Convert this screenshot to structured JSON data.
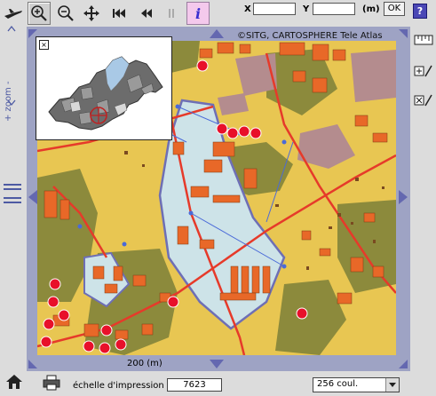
{
  "toolbar": {
    "tools": [
      {
        "name": "hand-pan"
      },
      {
        "name": "zoom-in",
        "active": true
      },
      {
        "name": "zoom-out"
      },
      {
        "name": "move"
      },
      {
        "name": "first-view"
      },
      {
        "name": "previous-view"
      },
      {
        "name": "next-view"
      },
      {
        "name": "info"
      }
    ],
    "info_label": "i",
    "x_label": "X",
    "y_label": "Y",
    "x_value": "",
    "y_value": "",
    "unit_label": "(m)",
    "ok_label": "OK",
    "help_label": "?"
  },
  "zoom": {
    "label": "+ zoom -"
  },
  "map": {
    "copyright": "©SITG, CARTOSPHERE Tele Atlas",
    "scale_label": "200 (m)",
    "colors": {
      "background": "#e8c652",
      "olive": "#8c8a3c",
      "buildings": "#e86828",
      "roads": "#e63a2a",
      "pale_zone": "#cde3e8",
      "mauve": "#b48c8e",
      "zone_border": "#6e6fb5",
      "markers": "#e8102a",
      "nav_arrows": "#6468b0"
    }
  },
  "status": {
    "print_scale_label": "échelle d'impression :",
    "print_scale_value": "7623",
    "color_mode": "256 coul."
  }
}
